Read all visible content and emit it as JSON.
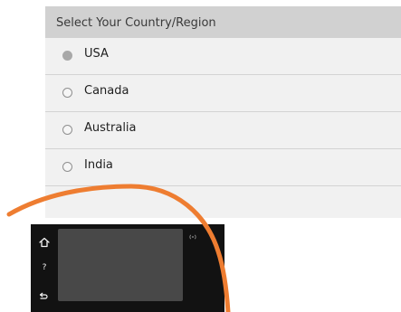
{
  "screen": {
    "title": "Select Your Country/Region",
    "options": [
      {
        "label": "USA",
        "selected": true
      },
      {
        "label": "Canada",
        "selected": false
      },
      {
        "label": "Australia",
        "selected": false
      },
      {
        "label": "India",
        "selected": false
      }
    ]
  },
  "colors": {
    "arc": "#ee7d31",
    "panel": "#121212",
    "display": "#484848",
    "header": "#d1d1d1",
    "screen_background": "#f1f1f1"
  },
  "control_panel": {
    "icons": [
      "home-icon",
      "help-icon",
      "back-icon",
      "wireless-icon"
    ]
  }
}
